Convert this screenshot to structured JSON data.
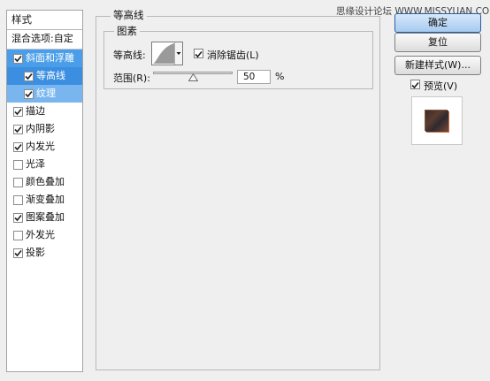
{
  "watermark": "思缘设计论坛 WWW.MISSYUAN.COM",
  "styles_panel": {
    "header": "样式",
    "blending_options": "混合选项:自定",
    "items": [
      {
        "label": "斜面和浮雕",
        "checked": true
      },
      {
        "label": "等高线",
        "checked": true
      },
      {
        "label": "纹理",
        "checked": true
      },
      {
        "label": "描边",
        "checked": true
      },
      {
        "label": "内阴影",
        "checked": true
      },
      {
        "label": "内发光",
        "checked": true
      },
      {
        "label": "光泽",
        "checked": false
      },
      {
        "label": "颜色叠加",
        "checked": false
      },
      {
        "label": "渐变叠加",
        "checked": false
      },
      {
        "label": "图案叠加",
        "checked": true
      },
      {
        "label": "外发光",
        "checked": false
      },
      {
        "label": "投影",
        "checked": true
      }
    ]
  },
  "contour_group": {
    "title": "等高线",
    "elements_title": "图素",
    "contour_label": "等高线:",
    "antialias_label": "消除锯齿(L)",
    "antialias_checked": true,
    "range_label": "范围(R):",
    "range_value": "50",
    "range_unit": "%",
    "range_level_percent": 50
  },
  "buttons": {
    "ok": "确定",
    "reset": "复位",
    "new_style": "新建样式(W)..."
  },
  "preview": {
    "label": "预览(V)",
    "checked": true
  },
  "colors": {
    "selected_row": "#4a9de8",
    "selected_sub_row": "#79b6ef",
    "dialog_bg": "#efefef"
  }
}
